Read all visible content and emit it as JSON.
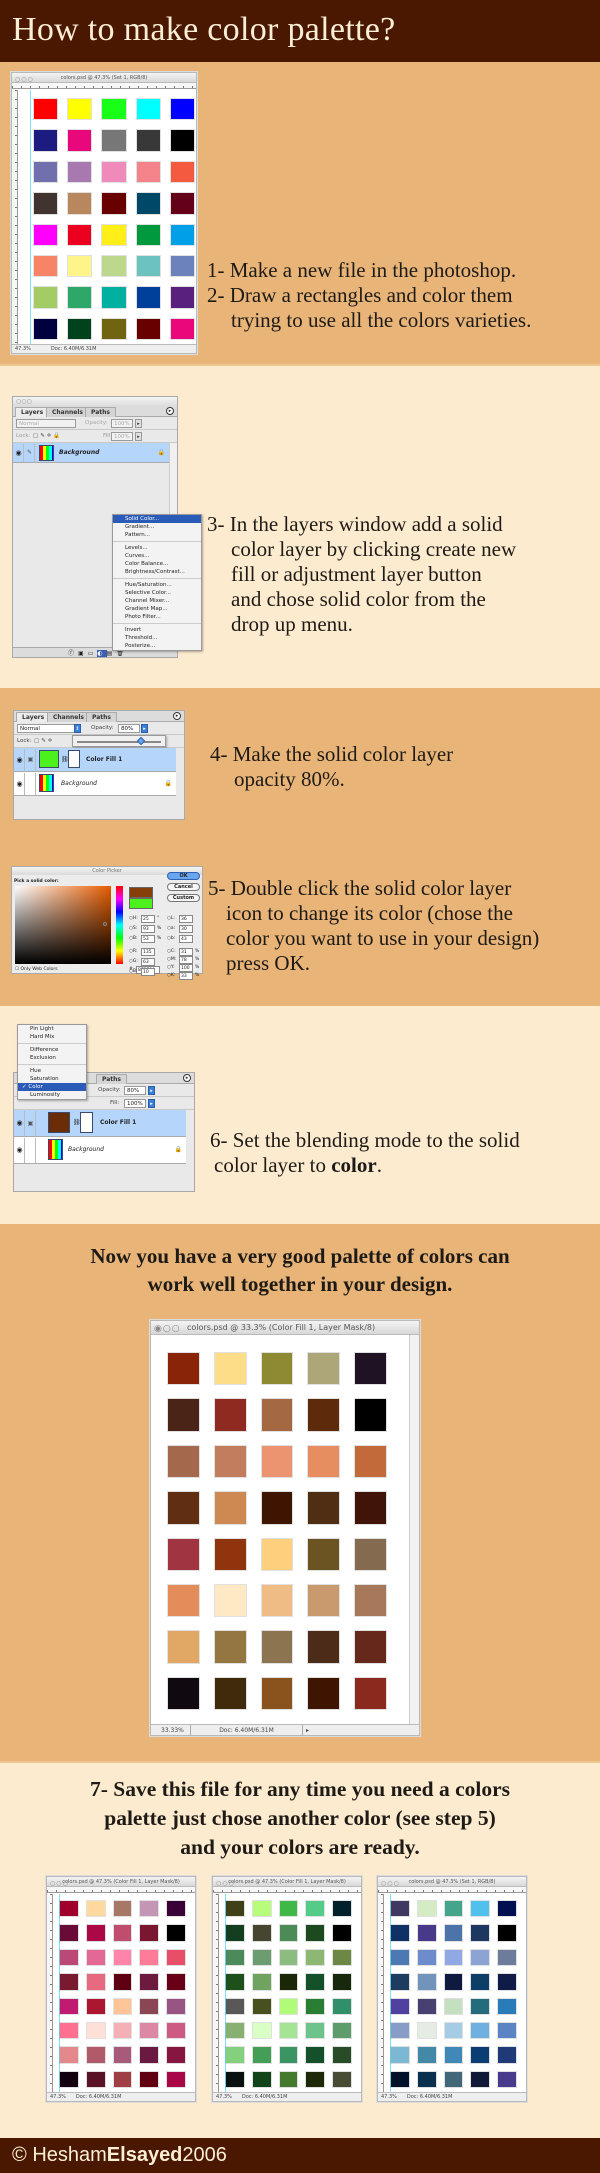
{
  "header": {
    "title": "How to make color palette?"
  },
  "colors": {
    "header_bg": "#4a1700",
    "tan_bg": "#e8b478",
    "cream_bg": "#fdebd0",
    "accent_blue": "#2b5bb8"
  },
  "steps": {
    "s1_2": {
      "line1": "1- Make a new file in the photoshop.",
      "line2": "2- Draw a rectangles and color them",
      "line3": "trying to use all the colors varieties."
    },
    "s3": {
      "line1": "3- In the layers window add a solid",
      "line2": "color layer by clicking create new",
      "line3": "fill or adjustment layer button",
      "line4": "and chose solid color from the",
      "line5": "drop up menu."
    },
    "s4": {
      "line1": "4- Make the solid color layer",
      "line2": "opacity 80%."
    },
    "s5": {
      "line1": "5- Double click the solid color layer",
      "line2": "icon to change its color (chose the",
      "line3": "color you want to use in your design)",
      "line4": "press OK."
    },
    "s6": {
      "line1": "6- Set the blending mode to the solid",
      "line2_pre": "color layer to ",
      "line2_bold": "color",
      "line2_post": "."
    },
    "summary": {
      "line1": "Now you have a very good palette of colors can",
      "line2": "work well together in your design."
    },
    "s7": {
      "line1": "7- Save this file for any time you need a colors",
      "line2": "palette just chose another color (see step 5)",
      "line3": "and your colors are ready."
    }
  },
  "doc1": {
    "title": "colors.psd @ 47.3% (Set 1, RGB/8)",
    "status_zoom": "47.3%",
    "status_doc": "Doc: 6.40M/6.31M",
    "swatches": [
      "#ff0000",
      "#ffff00",
      "#18ff18",
      "#00ffff",
      "#0000ff",
      "#1c1c80",
      "#e8087c",
      "#777777",
      "#383838",
      "#000000",
      "#716fae",
      "#a779b0",
      "#f08abb",
      "#f4848a",
      "#f45a40",
      "#403330",
      "#b9875e",
      "#690000",
      "#004868",
      "#640018",
      "#ff00ff",
      "#ec0020",
      "#ffee18",
      "#00993e",
      "#00a0e8",
      "#f88468",
      "#fff48a",
      "#bcd88c",
      "#6cc2be",
      "#6c82bc",
      "#a4cc64",
      "#2ea868",
      "#00b0a0",
      "#00409a",
      "#5a207e",
      "#000040",
      "#00421c",
      "#706410",
      "#680000",
      "#e8087c"
    ]
  },
  "layers_panel_1": {
    "tabs": [
      "Layers",
      "Channels",
      "Paths"
    ],
    "blend_mode": "Normal",
    "opacity_label": "Opacity:",
    "opacity_value": "100%",
    "lock_label": "Lock:",
    "fill_label": "Fill:",
    "fill_value": "100%",
    "layer_name": "Background",
    "menu": [
      "Solid Color...",
      "Gradient...",
      "Pattern...",
      "Levels...",
      "Curves...",
      "Color Balance...",
      "Brightness/Contrast...",
      "Hue/Saturation...",
      "Selective Color...",
      "Channel Mixer...",
      "Gradient Map...",
      "Photo Filter...",
      "Invert",
      "Threshold...",
      "Posterize..."
    ],
    "menu_selected": "Solid Color..."
  },
  "layers_panel_2": {
    "tabs": [
      "Layers",
      "Channels",
      "Paths"
    ],
    "blend_mode": "Normal",
    "opacity_label": "Opacity:",
    "opacity_value": "80%",
    "opacity_fraction": 0.8,
    "lock_label": "Lock:",
    "fill_layer_name": "Color Fill 1",
    "fill_color": "#4cf01c",
    "bg_layer_name": "Background"
  },
  "color_picker": {
    "title": "Color Picker",
    "prompt": "Pick a solid color:",
    "ok": "OK",
    "cancel": "Cancel",
    "custom": "Custom",
    "new_color": "#873f0a",
    "old_color": "#4cf01c",
    "fields": [
      {
        "label": "H:",
        "value": "25",
        "unit": "°"
      },
      {
        "label": "S:",
        "value": "93",
        "unit": "%"
      },
      {
        "label": "B:",
        "value": "53",
        "unit": "%"
      },
      {
        "label": "R:",
        "value": "135",
        "unit": ""
      },
      {
        "label": "G:",
        "value": "63",
        "unit": ""
      },
      {
        "label": "B:",
        "value": "10",
        "unit": ""
      }
    ],
    "lab_fields": [
      {
        "label": "L:",
        "value": "36"
      },
      {
        "label": "a:",
        "value": "30"
      },
      {
        "label": "b:",
        "value": "43"
      }
    ],
    "cmyk_fields": [
      {
        "label": "C:",
        "value": "31",
        "unit": "%"
      },
      {
        "label": "M:",
        "value": "78",
        "unit": "%"
      },
      {
        "label": "Y:",
        "value": "100",
        "unit": "%"
      },
      {
        "label": "K:",
        "value": "33",
        "unit": "%"
      }
    ],
    "hex_label": "#",
    "hex_value": "873F0A",
    "web_colors_label": "Only Web Colors"
  },
  "layers_panel_3": {
    "blend_menu": [
      "Pin Light",
      "Hard Mix",
      "Difference",
      "Exclusion",
      "Hue",
      "Saturation",
      "Color",
      "Luminosity"
    ],
    "blend_selected": "Color",
    "check": "✓",
    "paths_tab": "Paths",
    "opacity_label": "Opacity:",
    "opacity_value": "80%",
    "fill_label": "Fill:",
    "fill_value": "100%",
    "fill_layer_name": "Color Fill 1",
    "fill_color": "#6b2d08",
    "bg_layer_name": "Background"
  },
  "doc2": {
    "title": "colors.psd @ 33.3% (Color Fill 1, Layer Mask/8)",
    "status_zoom": "33.33%",
    "status_doc": "Doc: 6.40M/6.31M",
    "swatches": [
      "#8a2408",
      "#fedd88",
      "#8e8a34",
      "#aca678",
      "#1e1224",
      "#4a2416",
      "#8e2a20",
      "#a46842",
      "#5e2a0c",
      "#000000",
      "#a4684c",
      "#c27c5e",
      "#ec9470",
      "#e68e60",
      "#c26a3a",
      "#602e10",
      "#ce8852",
      "#3e1600",
      "#502e14",
      "#401408",
      "#a03440",
      "#90340e",
      "#fed07e",
      "#6c5422",
      "#846a4e",
      "#e48c5a",
      "#ffe8c4",
      "#eebc84",
      "#c89a6e",
      "#a8785a",
      "#e0a864",
      "#937640",
      "#8c7450",
      "#4c2c18",
      "#66281a",
      "#100a10",
      "#402a0c",
      "#8a521c",
      "#3e1600",
      "#8a2a1e"
    ]
  },
  "doc3": {
    "title": "colors.psd @ 47.3% (Color Fill 1, Layer Mask/8)",
    "status_zoom": "47.3%",
    "status_doc": "Doc: 6.40M/6.31M",
    "swatches": [
      "#a0002c",
      "#ffd8a0",
      "#a87866",
      "#c296b4",
      "#3a0038",
      "#6a0a36",
      "#ac0848",
      "#c04c6e",
      "#7a1630",
      "#000000",
      "#bc4878",
      "#e46896",
      "#ff84aa",
      "#ff7c98",
      "#e84e68",
      "#7a1a30",
      "#e86a80",
      "#5e0012",
      "#6c1a3e",
      "#6a0018",
      "#c01a72",
      "#ac1630",
      "#ffc498",
      "#8a4654",
      "#985482",
      "#ff7090",
      "#ffe0d8",
      "#f4b0b4",
      "#dc88a4",
      "#cc5a82",
      "#e4888c",
      "#b05a6a",
      "#a85a7a",
      "#6a1a40",
      "#861640",
      "#12000e",
      "#5a1226",
      "#a03e46",
      "#600010",
      "#a80848"
    ]
  },
  "doc4": {
    "title": "colors.psd @ 47.3% (Color Fill 1, Layer Mask/8)",
    "status_zoom": "47.3%",
    "status_doc": "Doc: 6.40M/6.31M",
    "swatches": [
      "#404018",
      "#b8fc7c",
      "#40b848",
      "#54cc88",
      "#00202c",
      "#143e20",
      "#464630",
      "#4c8a56",
      "#1c4a1e",
      "#000000",
      "#4c8a5c",
      "#6c9c70",
      "#8cbc80",
      "#8cb874",
      "#6c8844",
      "#1e501c",
      "#6ea460",
      "#1a2808",
      "#145028",
      "#18280c",
      "#585858",
      "#485020",
      "#b0fc78",
      "#2a7e34",
      "#30906a",
      "#88b070",
      "#daffc4",
      "#a4e494",
      "#6cc48a",
      "#5e9c6c",
      "#84d07c",
      "#449e56",
      "#3a9464",
      "#14502a",
      "#284c28",
      "#081010",
      "#12441a",
      "#447a2e",
      "#1c2808",
      "#484c34"
    ]
  },
  "doc5": {
    "title": "colors.psd @ 47.3% (Set 1, RGB/8)",
    "status_zoom": "47.3%",
    "status_doc": "Doc: 6.40M/6.31M",
    "swatches": [
      "#403860",
      "#d4ecc4",
      "#44a48c",
      "#50c0ec",
      "#001050",
      "#103068",
      "#483a88",
      "#4c74a8",
      "#1c3860",
      "#000000",
      "#4c78b4",
      "#6c8ccc",
      "#90a8e4",
      "#8ca4d4",
      "#6e7c9c",
      "#1e3c60",
      "#7094bc",
      "#0e1a40",
      "#0c3e68",
      "#101c48",
      "#5040a0",
      "#484070",
      "#c4e0c0",
      "#226c7e",
      "#2a7cb8",
      "#889cc8",
      "#e4ece4",
      "#a4cce4",
      "#70b0e0",
      "#5a84c4",
      "#7cb8d4",
      "#4488a8",
      "#4088b8",
      "#0c3c74",
      "#203a78",
      "#001028",
      "#0a3050",
      "#406878",
      "#101838",
      "#483a8c"
    ]
  },
  "footer": {
    "copy_symbol": "©",
    "name_regular": "Hesham",
    "name_bold": "Elsayed",
    "year": "2006"
  }
}
